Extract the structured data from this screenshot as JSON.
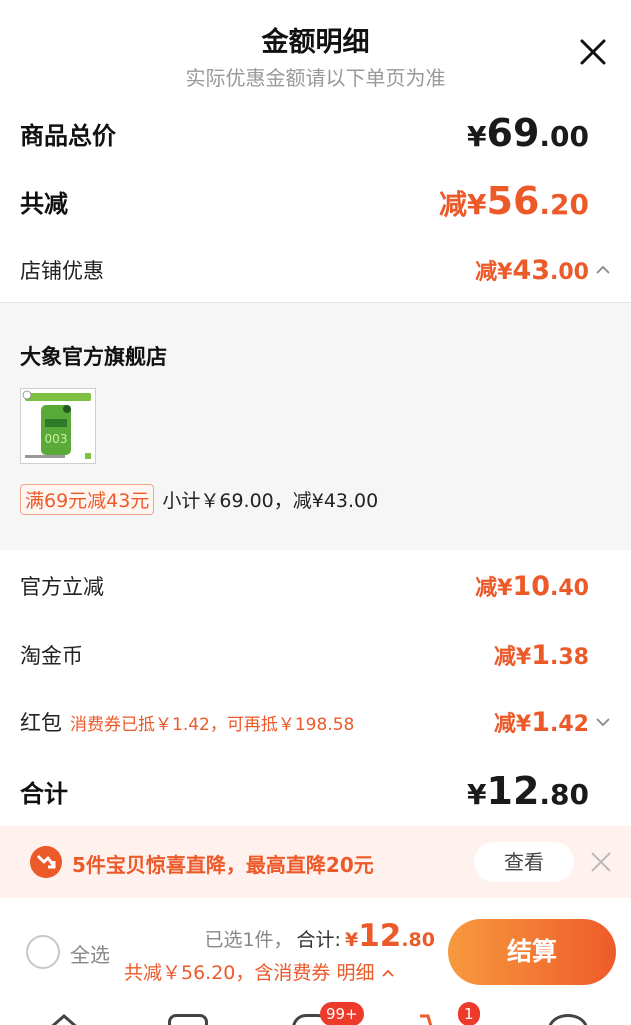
{
  "header": {
    "title": "金额明细",
    "subtitle": "实际优惠金额请以下单页为准"
  },
  "total_price": {
    "label": "商品总价",
    "symbol": "¥",
    "int": "69",
    "dec": ".00"
  },
  "total_discount": {
    "label": "共减",
    "prefix": "减",
    "symbol": "¥",
    "int": "56",
    "dec": ".20"
  },
  "store_discount": {
    "label": "店铺优惠",
    "prefix": "减",
    "symbol": "¥",
    "int": "43",
    "dec": ".00"
  },
  "store": {
    "name": "大象官方旗舰店",
    "promo_tag": "满69元减43元",
    "subtotal_text": "小计￥69.00，减¥43.00",
    "thumb_text": "003"
  },
  "official_discount": {
    "label": "官方立减",
    "prefix": "减",
    "symbol": "¥",
    "int": "10",
    "dec": ".40"
  },
  "taojinbi": {
    "label": "淘金币",
    "prefix": "减",
    "symbol": "¥",
    "int": "1",
    "dec": ".38"
  },
  "hongbao": {
    "label": "红包",
    "note": "消费券已抵￥1.42，可再抵￥198.58",
    "prefix": "减",
    "symbol": "¥",
    "int": "1",
    "dec": ".42"
  },
  "grand_total": {
    "label": "合计",
    "symbol": "¥",
    "int": "12",
    "dec": ".80"
  },
  "banner": {
    "text": "5件宝贝惊喜直降，最高直降20元",
    "button": "查看"
  },
  "footer": {
    "select_all": "全选",
    "selected": "已选1件，",
    "total_label": "合计:",
    "total_symbol": "¥",
    "total_int": "12",
    "total_dec": ".80",
    "discount_text": "共减￥56.20，含消费券",
    "detail_link": "明细",
    "checkout": "结算"
  },
  "tabbar": {
    "messages_badge": "99+",
    "cart_badge": "1"
  },
  "colors": {
    "accent": "#ec5a2a",
    "checkout_start": "#f79a3e",
    "checkout_end": "#ee5b2a"
  }
}
